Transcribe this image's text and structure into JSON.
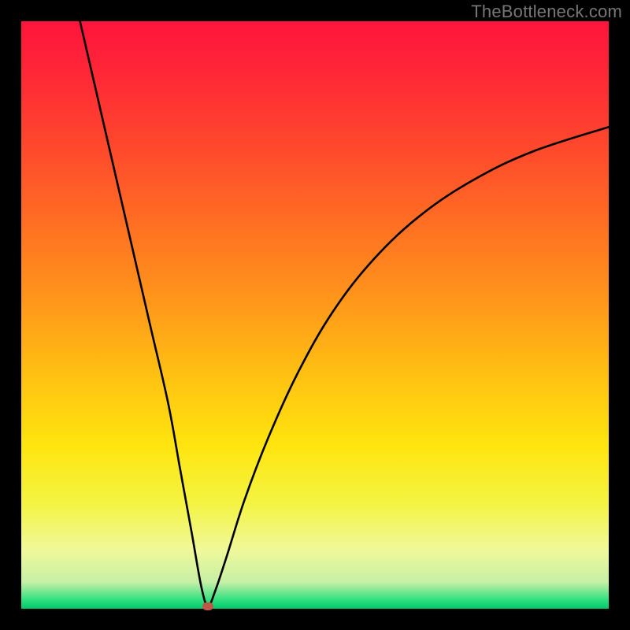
{
  "attribution": "TheBottleneck.com",
  "colors": {
    "gradient_stops": [
      {
        "offset": 0.0,
        "color": "#ff143c"
      },
      {
        "offset": 0.1,
        "color": "#ff2a36"
      },
      {
        "offset": 0.22,
        "color": "#ff4a2c"
      },
      {
        "offset": 0.35,
        "color": "#ff7022"
      },
      {
        "offset": 0.48,
        "color": "#ff981a"
      },
      {
        "offset": 0.6,
        "color": "#ffc012"
      },
      {
        "offset": 0.72,
        "color": "#ffe40e"
      },
      {
        "offset": 0.82,
        "color": "#f4f442"
      },
      {
        "offset": 0.9,
        "color": "#f0f89a"
      },
      {
        "offset": 0.955,
        "color": "#c6f0a6"
      },
      {
        "offset": 0.985,
        "color": "#30e080"
      },
      {
        "offset": 1.0,
        "color": "#00c86a"
      }
    ],
    "curve": "#000000",
    "min_marker": "#c05848",
    "background": "#000000"
  },
  "chart_data": {
    "type": "line",
    "title": "",
    "xlabel": "",
    "ylabel": "",
    "xlim": [
      0,
      100
    ],
    "ylim": [
      0,
      100
    ],
    "legend": false,
    "series": [
      {
        "name": "bottleneck-curve",
        "x": [
          10,
          13,
          16,
          19,
          22,
          25,
          27,
          29,
          30.7,
          31.8,
          33,
          35,
          38,
          42,
          47,
          53,
          60,
          68,
          77,
          87,
          100
        ],
        "y": [
          100,
          87,
          74,
          61,
          48,
          35,
          24,
          13,
          3.5,
          0.5,
          3,
          9,
          18.5,
          29,
          40,
          50.5,
          59.5,
          67,
          73,
          77.8,
          82
        ]
      }
    ],
    "minimum_point": {
      "x": 31.8,
      "y": 0.4
    }
  }
}
